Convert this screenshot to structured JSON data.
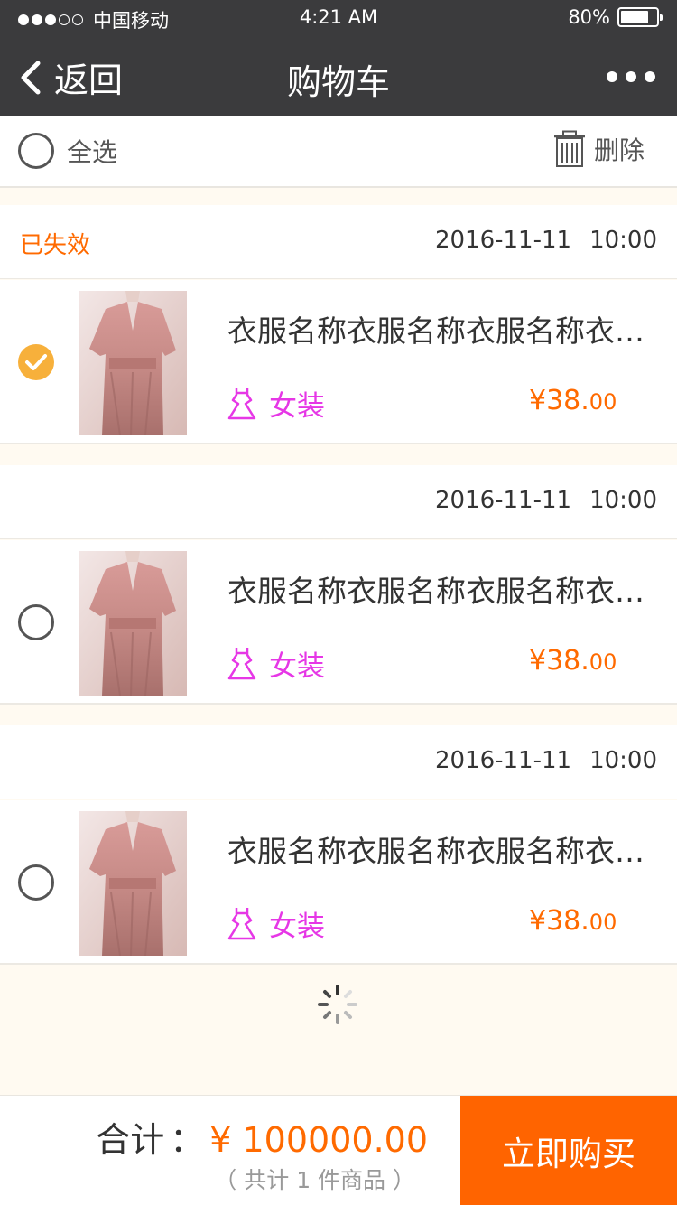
{
  "status_bar": {
    "carrier": "中国移动",
    "time": "4:21 AM",
    "battery": "80%",
    "battery_level": 0.8
  },
  "nav": {
    "back_label": "返回",
    "title": "购物车",
    "more_icon": "more-dots-icon"
  },
  "toolbar": {
    "select_all_label": "全选",
    "delete_label": "删除",
    "delete_icon": "trash-icon"
  },
  "groups": [
    {
      "status": "已失效",
      "date": "2016-11-11",
      "time": "10:00",
      "item": {
        "name": "衣服名称衣服名称衣服名称衣服名称",
        "category": "女装",
        "price_int": "¥38.",
        "price_dec": "00",
        "checked": true
      }
    },
    {
      "status": "",
      "date": "2016-11-11",
      "time": "10:00",
      "item": {
        "name": "衣服名称衣服名称衣服名称衣服名称",
        "category": "女装",
        "price_int": "¥38.",
        "price_dec": "00",
        "checked": false
      }
    },
    {
      "status": "",
      "date": "2016-11-11",
      "time": "10:00",
      "item": {
        "name": "衣服名称衣服名称衣服名称衣服名称",
        "category": "女装",
        "price_int": "¥38.",
        "price_dec": "00",
        "checked": false
      }
    }
  ],
  "footer": {
    "total_label": "合计",
    "total_colon": "：",
    "total_amount": "¥ 100000.00",
    "total_sub": "（ 共计 1 件商品 ）",
    "buy_label": "立即购买"
  },
  "colors": {
    "accent": "#ff6400",
    "category": "#e637e6",
    "check": "#f7b03b",
    "bar": "#3b3b3d"
  }
}
